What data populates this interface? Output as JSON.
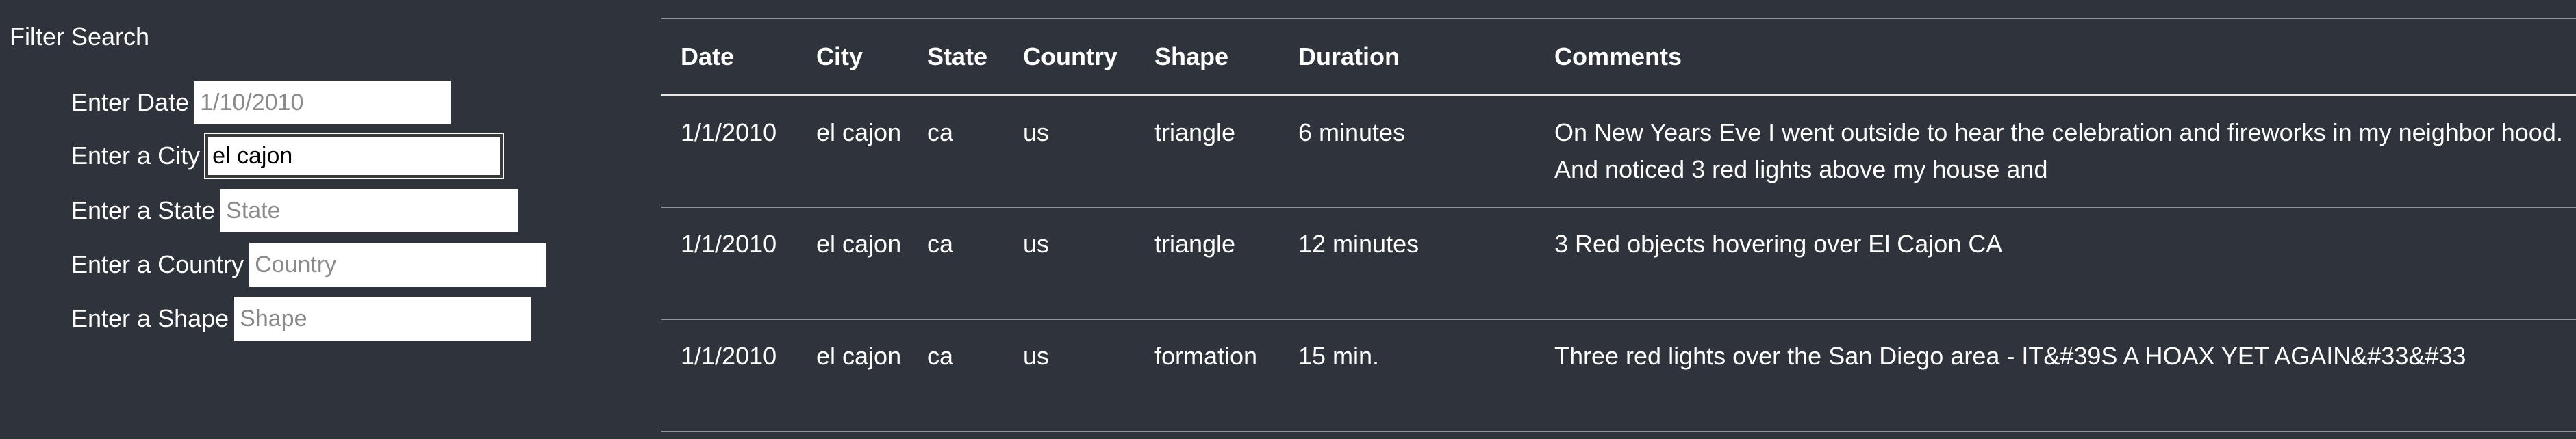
{
  "filter": {
    "title": "Filter Search",
    "fields": [
      {
        "label": "Enter Date",
        "value": "",
        "placeholder": "1/10/2010"
      },
      {
        "label": "Enter a City",
        "value": "el cajon",
        "placeholder": ""
      },
      {
        "label": "Enter a State",
        "value": "",
        "placeholder": "State"
      },
      {
        "label": "Enter a Country",
        "value": "",
        "placeholder": "Country"
      },
      {
        "label": "Enter a Shape",
        "value": "",
        "placeholder": "Shape"
      }
    ]
  },
  "table": {
    "headers": [
      "Date",
      "City",
      "State",
      "Country",
      "Shape",
      "Duration",
      "Comments"
    ],
    "rows": [
      [
        "1/1/2010",
        "el cajon",
        "ca",
        "us",
        "triangle",
        "6 minutes",
        "On New Years Eve I went outside to hear the celebration and fireworks in my neighbor hood. And noticed 3 red lights above my house and"
      ],
      [
        "1/1/2010",
        "el cajon",
        "ca",
        "us",
        "triangle",
        "12 minutes",
        "3 Red objects hovering over El Cajon CA"
      ],
      [
        "1/1/2010",
        "el cajon",
        "ca",
        "us",
        "formation",
        "15 min.",
        "Three red lights over the San Diego area - IT&#39S A HOAX YET AGAIN&#33&#33"
      ]
    ]
  }
}
